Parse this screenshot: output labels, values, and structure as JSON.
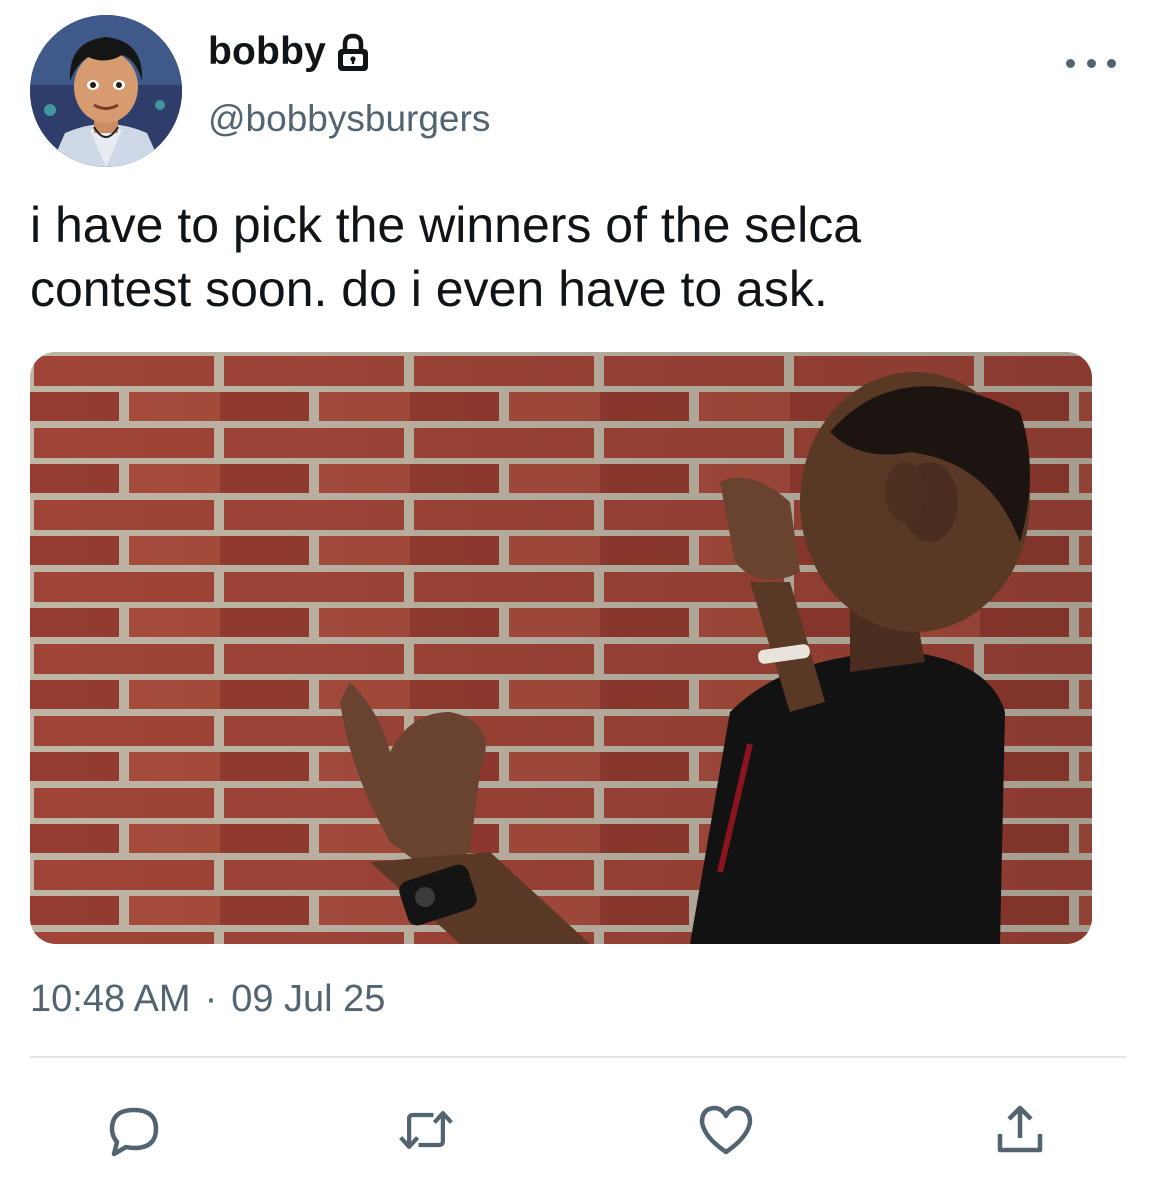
{
  "user": {
    "display_name": "bobby",
    "handle": "@bobbysburgers",
    "verified_icon": "lock-icon",
    "avatar_icon": "avatar"
  },
  "tweet": {
    "text": "i have to pick the winners of the selca\ncontest soon. do i even have to ask.",
    "time": "10:48 AM",
    "separator": "·",
    "date": "09 Jul 25",
    "media": {
      "description_icon": "meme-image"
    }
  },
  "actions": {
    "reply": "reply-icon",
    "retweet": "retweet-icon",
    "like": "heart-icon",
    "share": "share-icon",
    "more": "more-icon"
  },
  "colors": {
    "text": "#0f1419",
    "secondary": "#536471",
    "divider": "#e3e6e8",
    "brick": "#a8483a",
    "mortar": "#c9bfae"
  }
}
